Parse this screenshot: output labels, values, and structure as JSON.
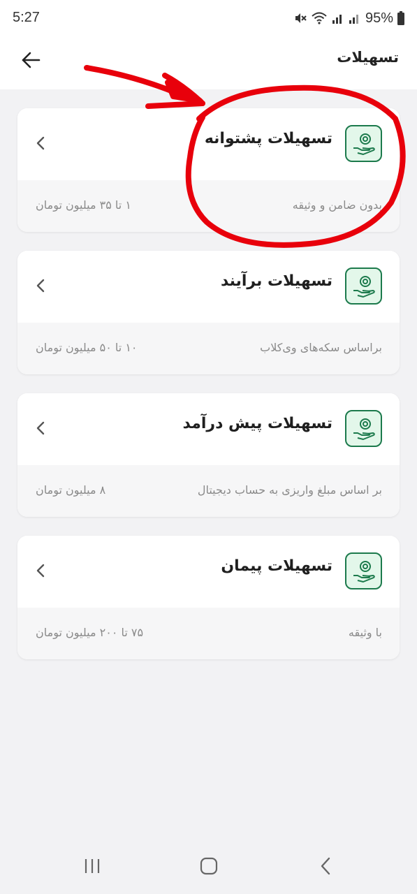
{
  "status_bar": {
    "time": "5:27",
    "battery": "95%"
  },
  "app_bar": {
    "title": "تسهیلات"
  },
  "cards": [
    {
      "title": "تسهیلات پشتوانه",
      "description": "بدون ضامن و وثیقه",
      "amount": "۱ تا ۳۵ میلیون تومان"
    },
    {
      "title": "تسهیلات برآیند",
      "description": "براساس سکه‌های وی‌کلاب",
      "amount": "۱۰ تا ۵۰ میلیون تومان"
    },
    {
      "title": "تسهیلات پیش درآمد",
      "description": "بر اساس مبلغ واریزی به حساب دیجیتال",
      "amount": "۸ میلیون تومان"
    },
    {
      "title": "تسهیلات پیمان",
      "description": "با وثیقه",
      "amount": "۷۵ تا ۲۰۰ میلیون تومان"
    }
  ],
  "colors": {
    "accent_green": "#1c7a4c",
    "icon_bg": "#e3f7ea",
    "annotation_red": "#e8000b"
  },
  "icons": {
    "back": "arrow-left-icon",
    "card_icon": "hand-coin-icon",
    "chevron": "chevron-left-icon"
  }
}
